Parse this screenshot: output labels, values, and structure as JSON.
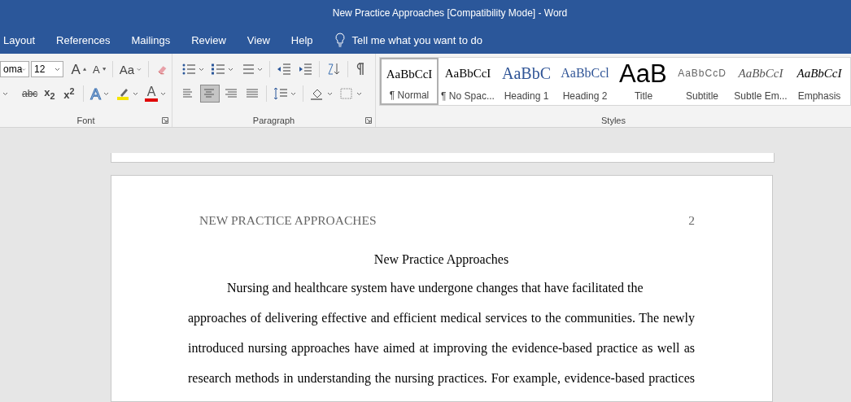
{
  "window": {
    "title": "New Practice Approaches [Compatibility Mode]  -  Word"
  },
  "tabs": [
    {
      "label": "Layout",
      "selected": false
    },
    {
      "label": "References",
      "selected": false
    },
    {
      "label": "Mailings",
      "selected": false
    },
    {
      "label": "Review",
      "selected": false
    },
    {
      "label": "View",
      "selected": false
    },
    {
      "label": "Help",
      "selected": false
    }
  ],
  "tell_me": "Tell me what you want to do",
  "ribbon": {
    "font": {
      "label": "Font",
      "font_name": "oma",
      "font_size": "12",
      "row1": [
        {
          "kind": "grow",
          "text": "A"
        },
        {
          "kind": "shrink",
          "text": "A"
        },
        {
          "kind": "case",
          "text": "Aa"
        },
        {
          "kind": "clear"
        }
      ],
      "row2": [
        {
          "kind": "underline"
        },
        {
          "kind": "strike",
          "text": "abc"
        },
        {
          "kind": "sub",
          "text": "x$_{2}$"
        },
        {
          "kind": "super",
          "text": "x$^{2}$"
        },
        {
          "kind": "effects",
          "text": "A"
        },
        {
          "kind": "highlight"
        },
        {
          "kind": "color",
          "text": "A"
        }
      ]
    },
    "paragraph": {
      "label": "Paragraph",
      "alignment": [
        {
          "selected": false
        },
        {
          "selected": true
        },
        {
          "selected": false
        },
        {
          "selected": false
        }
      ]
    },
    "styles": {
      "label": "Styles",
      "items": [
        {
          "kind": "normal",
          "preview": "AaBbCcI",
          "label": "¶ Normal",
          "selected": true
        },
        {
          "kind": "normal",
          "preview": "AaBbCcI",
          "label": "¶ No Spac...",
          "selected": false
        },
        {
          "kind": "heading1",
          "preview": "AaBbC",
          "label": "Heading 1",
          "selected": false
        },
        {
          "kind": "heading2",
          "preview": "AaBbCcl",
          "label": "Heading 2",
          "selected": false
        },
        {
          "kind": "title",
          "preview": "AaB",
          "label": "Title",
          "selected": false
        },
        {
          "kind": "subtitle",
          "preview": "AaBbCcD",
          "label": "Subtitle",
          "selected": false
        },
        {
          "kind": "subtle",
          "preview": "AaBbCcI",
          "label": "Subtle Em...",
          "selected": false
        },
        {
          "kind": "emphasis",
          "preview": "AaBbCcI",
          "label": "Emphasis",
          "selected": false
        }
      ]
    }
  },
  "document": {
    "header": "NEW PRACTICE APPROACHES",
    "page_number": "2",
    "title": "New Practice Approaches",
    "lines": [
      "Nursing and healthcare system have undergone changes that have facilitated the",
      "approaches of delivering effective and efficient medical services to the communities. The newly",
      "introduced nursing approaches have aimed at improving the evidence-based practice as well as",
      "research methods in understanding the nursing practices. For example, evidence-based practices"
    ]
  }
}
